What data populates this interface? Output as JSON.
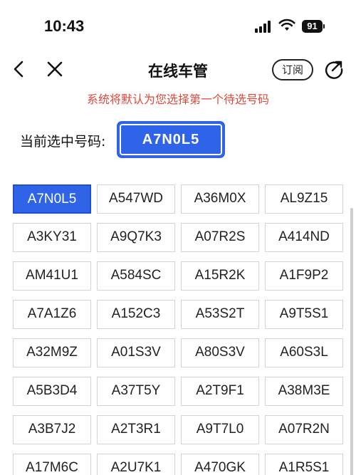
{
  "status_bar": {
    "time": "10:43",
    "battery": "91"
  },
  "nav": {
    "title": "在线车管",
    "subscribe_label": "订阅"
  },
  "notice": "系统将默认为您选择第一个待选号码",
  "current": {
    "label": "当前选中号码:",
    "plate": "A7N0L5"
  },
  "colors": {
    "accent": "#2f63e8",
    "notice": "#e0483a"
  },
  "plates": [
    [
      "A7N0L5",
      "A547WD",
      "A36M0X",
      "AL9Z15"
    ],
    [
      "A3KY31",
      "A9Q7K3",
      "A07R2S",
      "A414ND"
    ],
    [
      "AM41U1",
      "A584SC",
      "A15R2K",
      "A1F9P2"
    ],
    [
      "A7A1Z6",
      "A152C3",
      "A53S2T",
      "A9T5S1"
    ],
    [
      "A32M9Z",
      "A01S3V",
      "A80S3V",
      "A60S3L"
    ],
    [
      "A5B3D4",
      "A37T5Y",
      "A2T9F1",
      "A38M3E"
    ],
    [
      "A3B7J2",
      "A2T3R1",
      "A9T7L0",
      "A07R2N"
    ],
    [
      "A17M6C",
      "A2U7K1",
      "A470GK",
      "A1R5S1"
    ]
  ],
  "selected_plate": "A7N0L5"
}
